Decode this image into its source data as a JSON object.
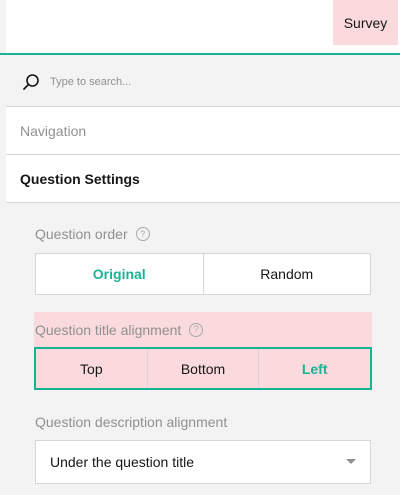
{
  "header": {
    "survey_tab": "Survey"
  },
  "search": {
    "placeholder": "Type to search...",
    "icon": "search-icon"
  },
  "sections": {
    "navigation": "Navigation",
    "question_settings": "Question Settings"
  },
  "question_order": {
    "label": "Question order",
    "help": "?",
    "options": [
      "Original",
      "Random"
    ],
    "selected": "Original"
  },
  "title_alignment": {
    "label": "Question title alignment",
    "help": "?",
    "options": [
      "Top",
      "Bottom",
      "Left"
    ],
    "selected": "Left"
  },
  "description_alignment": {
    "label": "Question description alignment",
    "value": "Under the question title"
  },
  "colors": {
    "accent": "#19b394",
    "highlight": "#fadadd",
    "background": "#f3f3f3"
  }
}
